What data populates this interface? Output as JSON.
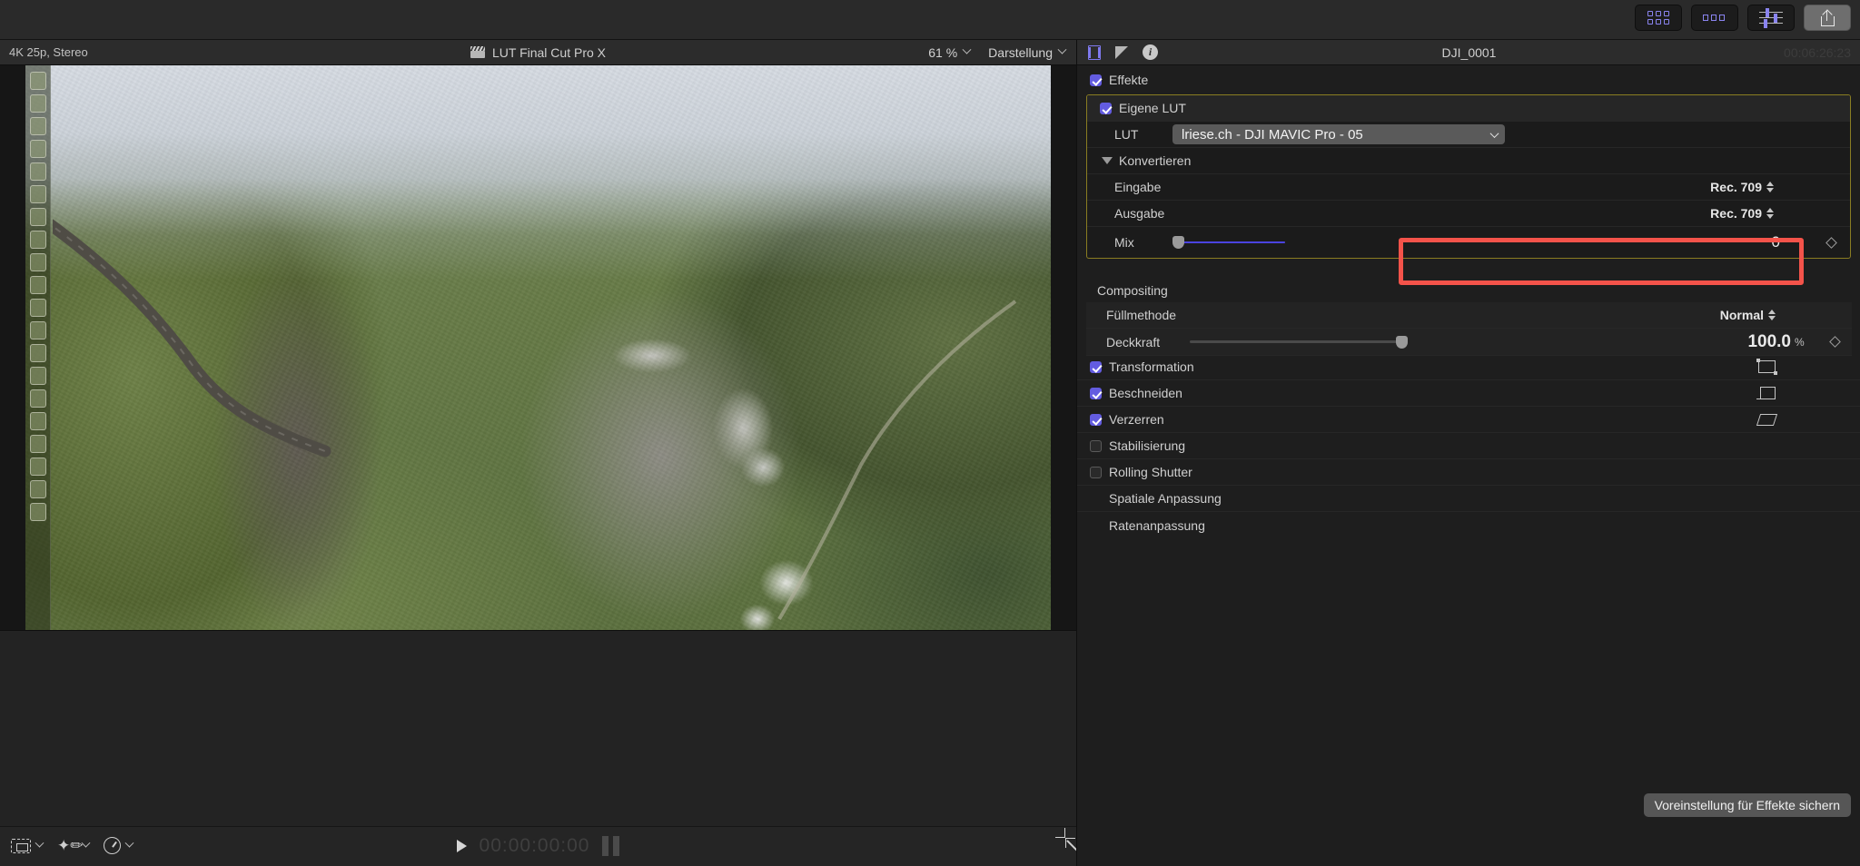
{
  "toolbar": {
    "buttons": [
      {
        "name": "browser-icon",
        "label": ""
      },
      {
        "name": "timeline-icon",
        "label": ""
      },
      {
        "name": "inspector-icon",
        "label": ""
      }
    ],
    "share_label": ""
  },
  "viewer": {
    "format_info": "4K 25p, Stereo",
    "project_title": "LUT Final Cut Pro X",
    "zoom_level": "61 %",
    "view_menu": "Darstellung",
    "timecode": "00:00:00:00"
  },
  "inspector": {
    "clip_name": "DJI_0001",
    "duration_timecode": "00:06:26:23",
    "effects": {
      "label": "Effekte",
      "checked": true
    },
    "custom_lut": {
      "label": "Eigene LUT",
      "checked": true,
      "lut_field_label": "LUT",
      "lut_value": "lriese.ch - DJI MAVIC Pro - 05",
      "convert_label": "Konvertieren",
      "input_label": "Eingabe",
      "input_value": "Rec. 709",
      "output_label": "Ausgabe",
      "output_value": "Rec. 709",
      "mix_label": "Mix",
      "mix_value": "0",
      "mix_percent": 0
    },
    "compositing": {
      "title": "Compositing",
      "blend_label": "Füllmethode",
      "blend_value": "Normal",
      "opacity_label": "Deckkraft",
      "opacity_value": "100.0",
      "opacity_unit": "%",
      "opacity_percent": 100
    },
    "sections": [
      {
        "label": "Transformation",
        "checked": true,
        "icon": "transform-icon"
      },
      {
        "label": "Beschneiden",
        "checked": true,
        "icon": "crop-icon"
      },
      {
        "label": "Verzerren",
        "checked": true,
        "icon": "distort-icon"
      }
    ],
    "toggles": [
      {
        "label": "Stabilisierung",
        "checked": false
      },
      {
        "label": "Rolling Shutter",
        "checked": false
      }
    ],
    "plain_rows": [
      {
        "label": "Spatiale Anpassung"
      },
      {
        "label": "Ratenanpassung"
      }
    ],
    "save_preset_label": "Voreinstellung für Effekte sichern"
  },
  "colors": {
    "accent_purple": "#635ce0",
    "slider_blue": "#4a43e0",
    "highlight_yellow": "#8a7d22",
    "annotation_red": "#f4534a"
  }
}
